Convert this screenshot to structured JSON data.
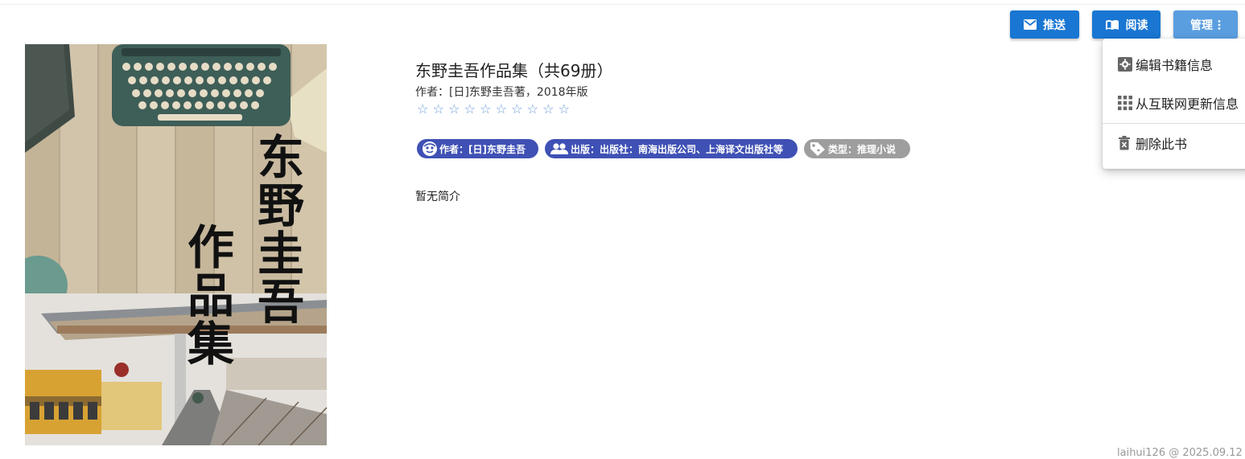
{
  "toolbar": {
    "push_label": "推送",
    "read_label": "阅读",
    "manage_label": "管理"
  },
  "cover": {
    "title_a": "东野圭吾",
    "title_b": "作品集"
  },
  "book": {
    "title": "东野圭吾作品集（共69册）",
    "author_line": "作者：[日]东野圭吾著，2018年版",
    "rating_stars": 10,
    "summary": "暂无简介"
  },
  "chips": {
    "author": "作者：[日]东野圭吾",
    "publisher": "出版：出版社：南海出版公司、上海译文出版社等",
    "type": "类型：推理小说"
  },
  "menu": {
    "edit": "编辑书籍信息",
    "update": "从互联网更新信息",
    "delete": "删除此书"
  },
  "footer": {
    "text": "laihui126 @ 2025.09.12"
  },
  "colors": {
    "primary": "#1976d2",
    "manage": "#5a9ee0",
    "chip_blue": "#3f51b5",
    "chip_grey": "#9e9e9e",
    "star": "#6a9bd8"
  }
}
